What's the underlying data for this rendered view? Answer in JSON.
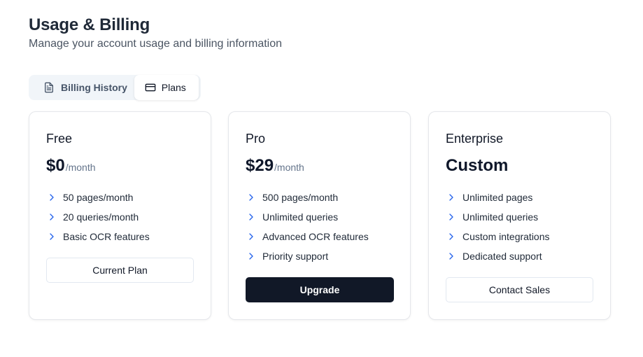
{
  "header": {
    "title": "Usage & Billing",
    "subtitle": "Manage your account usage and billing information"
  },
  "tabs": [
    {
      "label": "Billing History",
      "icon": "file-text-icon",
      "active": false
    },
    {
      "label": "Plans",
      "icon": "credit-card-icon",
      "active": true
    }
  ],
  "plans": {
    "free": {
      "name": "Free",
      "price": "$0",
      "period": "/month",
      "features": [
        "50 pages/month",
        "20 queries/month",
        "Basic OCR features"
      ],
      "button": "Current Plan"
    },
    "pro": {
      "name": "Pro",
      "price": "$29",
      "period": "/month",
      "features": [
        "500 pages/month",
        "Unlimited queries",
        "Advanced OCR features",
        "Priority support"
      ],
      "button": "Upgrade"
    },
    "enterprise": {
      "name": "Enterprise",
      "price": "Custom",
      "features": [
        "Unlimited pages",
        "Unlimited queries",
        "Custom integrations",
        "Dedicated support"
      ],
      "button": "Contact Sales"
    }
  },
  "colors": {
    "accent": "#2563eb",
    "primary_button": "#111827",
    "muted_text": "#64748b"
  }
}
